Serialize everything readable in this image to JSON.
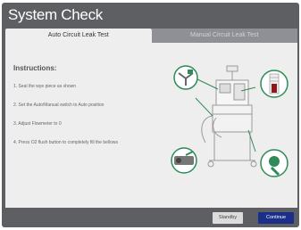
{
  "window": {
    "title": "System Check"
  },
  "tabs": [
    {
      "label": "Auto Circuit Leak Test",
      "active": true
    },
    {
      "label": "Manual Circuit Leak Test",
      "active": false
    }
  ],
  "instructions": {
    "title": "Instructions:",
    "steps": [
      "1. Seal the wye piece as shown",
      "2. Set the Auto/Manual switch to Auto position",
      "3. Adjust Flowmeter to 0",
      "4. Press O2 flush button to completely fill the bellows"
    ]
  },
  "diagram": {
    "callout_color": "#2e8b57",
    "flowmeter_color": "#8b1a1a",
    "icons": [
      "wye-piece-icon",
      "switch-icon",
      "flowmeter-icon",
      "o2-flush-icon",
      "anesthesia-machine-icon"
    ]
  },
  "footer": {
    "standby_label": "Standby",
    "continue_label": "Continue"
  },
  "colors": {
    "background": "#5d5f63",
    "primary_button": "#1a2e8a",
    "content_bg": "#eeeeee"
  }
}
